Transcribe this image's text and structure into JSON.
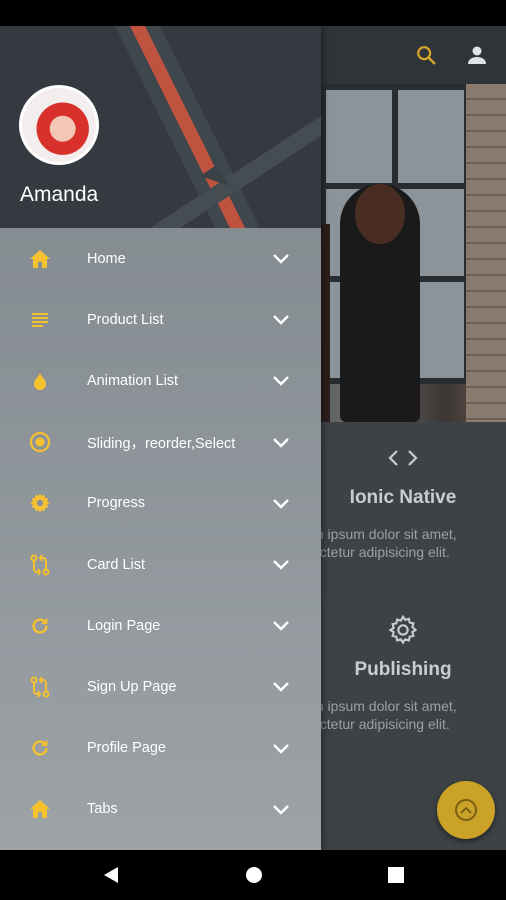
{
  "drawer": {
    "user_name": "Amanda",
    "accent_color": "#f5c12e",
    "items": [
      {
        "label": "Home",
        "icon": "home-icon"
      },
      {
        "label": "Product List",
        "icon": "list-icon"
      },
      {
        "label": "Animation List",
        "icon": "drop-icon"
      },
      {
        "label": "Sliding，reorder,Select",
        "icon": "radio-button-icon"
      },
      {
        "label": "Progress",
        "icon": "gear-icon"
      },
      {
        "label": "Card List",
        "icon": "swap-icon"
      },
      {
        "label": "Login Page",
        "icon": "refresh-icon"
      },
      {
        "label": "Sign Up Page",
        "icon": "swap-icon"
      },
      {
        "label": "Profile Page",
        "icon": "refresh-icon"
      },
      {
        "label": "Tabs",
        "icon": "home-icon"
      }
    ]
  },
  "content": {
    "feature1": {
      "icon": "code-icon",
      "title": "Ionic Native",
      "text_line1": "m ipsum dolor sit amet,",
      "text_line2": "ectetur adipisicing elit."
    },
    "feature2": {
      "icon": "cog-icon",
      "title": "Publishing",
      "text_line1": "m ipsum dolor sit amet,",
      "text_line2": "ectetur adipisicing elit."
    }
  },
  "colors": {
    "accent": "#f5c12e",
    "fab": "#c9a227",
    "header_stripe_red": "#c0533f"
  }
}
